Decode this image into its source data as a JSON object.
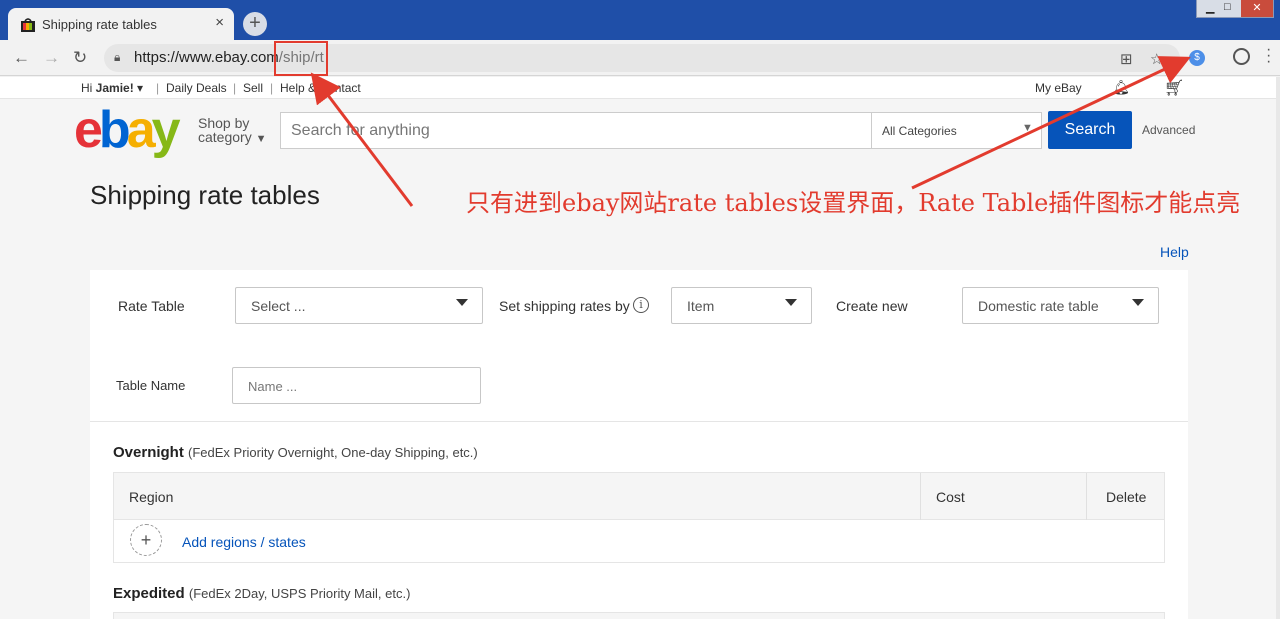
{
  "browser": {
    "tab_title": "Shipping rate tables",
    "tab_close": "×",
    "new_tab": "+",
    "url_host": "https://www.ebay.com",
    "url_path": "/ship/rt",
    "extension_badge": "$"
  },
  "ebay_header": {
    "greeting_prefix": "Hi ",
    "user_name": "Jamie!",
    "links": [
      "Daily Deals",
      "Sell",
      "Help & Contact"
    ],
    "my_ebay": "My eBay",
    "shop_by": "Shop by",
    "category": "category",
    "search_placeholder": "Search for anything",
    "category_select": "All Categories",
    "search_button": "Search",
    "advanced": "Advanced",
    "logo_letters": [
      "e",
      "b",
      "a",
      "y"
    ],
    "logo_colors": [
      "#e53238",
      "#0064d2",
      "#f5af02",
      "#86b817"
    ]
  },
  "page": {
    "title": "Shipping rate tables",
    "annotation": "只有进到ebay网站rate tables设置界面，Rate Table插件图标才能点亮",
    "annotation_color": "#e23b2e",
    "help": "Help"
  },
  "form": {
    "rate_table_label": "Rate Table",
    "rate_table_value": "Select ...",
    "rates_by_label": "Set shipping rates by",
    "info_glyph": "i",
    "rates_by_value": "Item",
    "create_new_label": "Create new",
    "create_new_value": "Domestic rate table",
    "table_name_label": "Table Name",
    "table_name_placeholder": "Name ..."
  },
  "sections": [
    {
      "title": "Overnight",
      "subtitle": "(FedEx Priority Overnight, One-day Shipping, etc.)",
      "columns": [
        "Region",
        "Cost",
        "Delete"
      ],
      "add_link": "Add regions / states"
    },
    {
      "title": "Expedited",
      "subtitle": "(FedEx 2Day, USPS Priority Mail, etc.)"
    }
  ]
}
